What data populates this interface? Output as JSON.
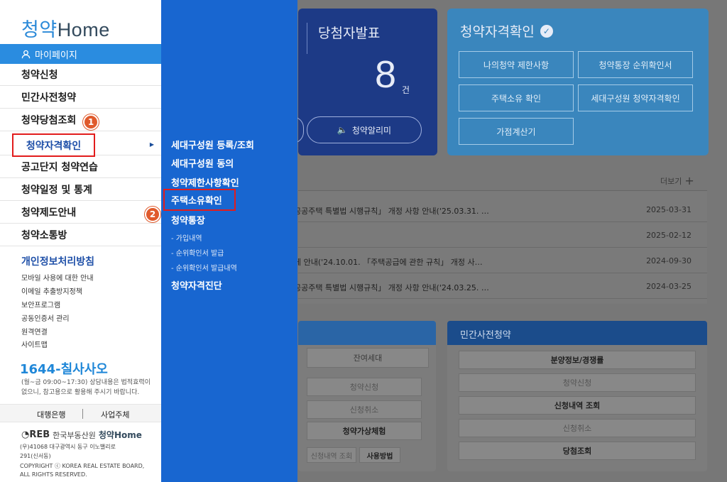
{
  "sidebar": {
    "logo_prefix": "청약",
    "logo_suffix": "Home",
    "mypage_label": "마이페이지",
    "menu": [
      {
        "label": "청약신청"
      },
      {
        "label": "민간사전청약"
      },
      {
        "label": "청약당첨조회"
      },
      {
        "label": "청약자격확인"
      },
      {
        "label": "공고단지 청약연습"
      },
      {
        "label": "청약일정 및 통계"
      },
      {
        "label": "청약제도안내"
      },
      {
        "label": "청약소통방"
      }
    ],
    "privacy_title": "개인정보처리방침",
    "links": [
      "모바일 사용에 대한 안내",
      "이메일 추출방지정책",
      "보안프로그램",
      "공동인증서 관리",
      "원격연결",
      "사이트맵"
    ],
    "phone": "1644-칠사사오",
    "phone_note": "(월~금 09:00~17:30) 상담내용은 법적효력이 없으니, 참고용으로 활용해 주시기 바랍니다.",
    "footer_a": "대행은행",
    "footer_b": "사업주체",
    "org": "한국부동산원",
    "org_logo": "REB",
    "address1": "(우)41068 대구광역시 동구 이노밸리로",
    "address2": "291(신서동)",
    "copyright": "COPYRIGHT ⓒ KOREA REAL ESTATE BOARD,",
    "rights": "ALL RIGHTS RESERVED."
  },
  "steps": {
    "one": "1",
    "two": "2"
  },
  "submenu": {
    "items": [
      "세대구성원 등록/조회",
      "세대구성원 동의",
      "청약제한사항확인",
      "주택소유확인",
      "청약통장"
    ],
    "sub_items": [
      "- 가입내역",
      "- 순위확인서 발급",
      "- 순위확인서 발급내역"
    ],
    "last_item": "청약자격진단"
  },
  "background": {
    "winner_title": "당첨자발표",
    "winner_count": "8",
    "winner_unit": "건",
    "alarm_label": "청약알리미",
    "qual_title": "청약자격확인",
    "qual_buttons": [
      "나의청약 제한사항",
      "청약통장 순위확인서",
      "주택소유 확인",
      "세대구성원 청약자격확인",
      "가점계산기"
    ],
    "more_label": "더보기",
    "notices": [
      {
        "title": "공공주택 특별법 시행규칙」 개정 사항 안내('25.03.31. …",
        "date": "2025-03-31"
      },
      {
        "title": "",
        "date": "2025-02-12"
      },
      {
        "title": "에 안내('24.10.01. 「주택공급에 관한 규칙」 개정 사…",
        "date": "2024-09-30"
      },
      {
        "title": "공공주택 특별법 시행규칙」 개정 사항 안내('24.03.25. …",
        "date": "2024-03-25"
      }
    ],
    "left_panel": {
      "remaining": "잔여세대",
      "apply": "청약신청",
      "cancel": "신청취소",
      "practice": "청약가상체험",
      "history": "신청내역 조회",
      "howto": "사용방법"
    },
    "right_panel": {
      "title": "민간사전청약",
      "buttons": [
        "분양정보/경쟁률",
        "청약신청",
        "신청내역 조회",
        "신청취소",
        "당첨조회"
      ]
    }
  }
}
